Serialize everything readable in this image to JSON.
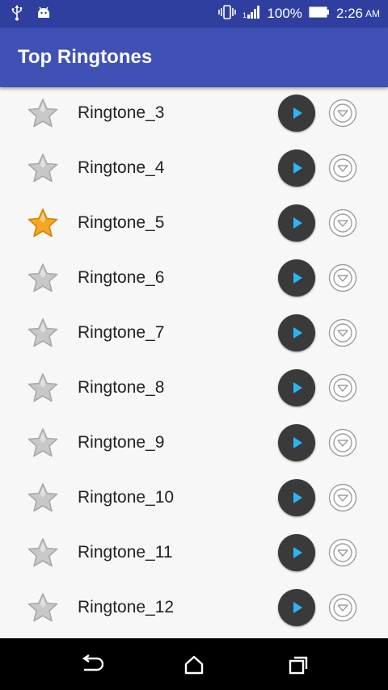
{
  "status_bar": {
    "battery_percent": "100%",
    "time": "2:26",
    "ampm": "AM",
    "icons": [
      "usb-icon",
      "android-icon",
      "vibrate-icon",
      "signal-icon",
      "battery-icon"
    ]
  },
  "app_bar": {
    "title": "Top Ringtones"
  },
  "ringtones": [
    {
      "label": "Ringtone_3",
      "favorite": false
    },
    {
      "label": "Ringtone_4",
      "favorite": false
    },
    {
      "label": "Ringtone_5",
      "favorite": true
    },
    {
      "label": "Ringtone_6",
      "favorite": false
    },
    {
      "label": "Ringtone_7",
      "favorite": false
    },
    {
      "label": "Ringtone_8",
      "favorite": false
    },
    {
      "label": "Ringtone_9",
      "favorite": false
    },
    {
      "label": "Ringtone_10",
      "favorite": false
    },
    {
      "label": "Ringtone_11",
      "favorite": false
    },
    {
      "label": "Ringtone_12",
      "favorite": false
    }
  ],
  "colors": {
    "status_bar": "#2f3fa0",
    "app_bar": "#3f51b5",
    "play_button": "#3a3a3a",
    "play_triangle": "#29b6f6",
    "star_favorite": "#f5a623",
    "star_default": "#c8c8c8"
  },
  "nav_bar": {
    "icons": [
      "back-icon",
      "home-icon",
      "recents-icon"
    ]
  }
}
